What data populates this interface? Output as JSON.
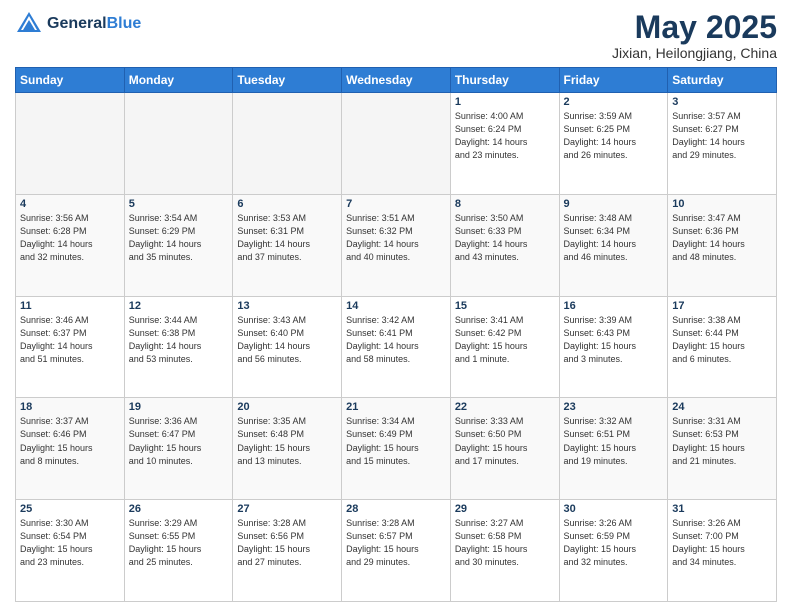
{
  "logo": {
    "line1": "General",
    "line2": "Blue"
  },
  "header": {
    "month": "May 2025",
    "location": "Jixian, Heilongjiang, China"
  },
  "days_of_week": [
    "Sunday",
    "Monday",
    "Tuesday",
    "Wednesday",
    "Thursday",
    "Friday",
    "Saturday"
  ],
  "weeks": [
    [
      {
        "day": "",
        "info": ""
      },
      {
        "day": "",
        "info": ""
      },
      {
        "day": "",
        "info": ""
      },
      {
        "day": "",
        "info": ""
      },
      {
        "day": "1",
        "info": "Sunrise: 4:00 AM\nSunset: 6:24 PM\nDaylight: 14 hours\nand 23 minutes."
      },
      {
        "day": "2",
        "info": "Sunrise: 3:59 AM\nSunset: 6:25 PM\nDaylight: 14 hours\nand 26 minutes."
      },
      {
        "day": "3",
        "info": "Sunrise: 3:57 AM\nSunset: 6:27 PM\nDaylight: 14 hours\nand 29 minutes."
      }
    ],
    [
      {
        "day": "4",
        "info": "Sunrise: 3:56 AM\nSunset: 6:28 PM\nDaylight: 14 hours\nand 32 minutes."
      },
      {
        "day": "5",
        "info": "Sunrise: 3:54 AM\nSunset: 6:29 PM\nDaylight: 14 hours\nand 35 minutes."
      },
      {
        "day": "6",
        "info": "Sunrise: 3:53 AM\nSunset: 6:31 PM\nDaylight: 14 hours\nand 37 minutes."
      },
      {
        "day": "7",
        "info": "Sunrise: 3:51 AM\nSunset: 6:32 PM\nDaylight: 14 hours\nand 40 minutes."
      },
      {
        "day": "8",
        "info": "Sunrise: 3:50 AM\nSunset: 6:33 PM\nDaylight: 14 hours\nand 43 minutes."
      },
      {
        "day": "9",
        "info": "Sunrise: 3:48 AM\nSunset: 6:34 PM\nDaylight: 14 hours\nand 46 minutes."
      },
      {
        "day": "10",
        "info": "Sunrise: 3:47 AM\nSunset: 6:36 PM\nDaylight: 14 hours\nand 48 minutes."
      }
    ],
    [
      {
        "day": "11",
        "info": "Sunrise: 3:46 AM\nSunset: 6:37 PM\nDaylight: 14 hours\nand 51 minutes."
      },
      {
        "day": "12",
        "info": "Sunrise: 3:44 AM\nSunset: 6:38 PM\nDaylight: 14 hours\nand 53 minutes."
      },
      {
        "day": "13",
        "info": "Sunrise: 3:43 AM\nSunset: 6:40 PM\nDaylight: 14 hours\nand 56 minutes."
      },
      {
        "day": "14",
        "info": "Sunrise: 3:42 AM\nSunset: 6:41 PM\nDaylight: 14 hours\nand 58 minutes."
      },
      {
        "day": "15",
        "info": "Sunrise: 3:41 AM\nSunset: 6:42 PM\nDaylight: 15 hours\nand 1 minute."
      },
      {
        "day": "16",
        "info": "Sunrise: 3:39 AM\nSunset: 6:43 PM\nDaylight: 15 hours\nand 3 minutes."
      },
      {
        "day": "17",
        "info": "Sunrise: 3:38 AM\nSunset: 6:44 PM\nDaylight: 15 hours\nand 6 minutes."
      }
    ],
    [
      {
        "day": "18",
        "info": "Sunrise: 3:37 AM\nSunset: 6:46 PM\nDaylight: 15 hours\nand 8 minutes."
      },
      {
        "day": "19",
        "info": "Sunrise: 3:36 AM\nSunset: 6:47 PM\nDaylight: 15 hours\nand 10 minutes."
      },
      {
        "day": "20",
        "info": "Sunrise: 3:35 AM\nSunset: 6:48 PM\nDaylight: 15 hours\nand 13 minutes."
      },
      {
        "day": "21",
        "info": "Sunrise: 3:34 AM\nSunset: 6:49 PM\nDaylight: 15 hours\nand 15 minutes."
      },
      {
        "day": "22",
        "info": "Sunrise: 3:33 AM\nSunset: 6:50 PM\nDaylight: 15 hours\nand 17 minutes."
      },
      {
        "day": "23",
        "info": "Sunrise: 3:32 AM\nSunset: 6:51 PM\nDaylight: 15 hours\nand 19 minutes."
      },
      {
        "day": "24",
        "info": "Sunrise: 3:31 AM\nSunset: 6:53 PM\nDaylight: 15 hours\nand 21 minutes."
      }
    ],
    [
      {
        "day": "25",
        "info": "Sunrise: 3:30 AM\nSunset: 6:54 PM\nDaylight: 15 hours\nand 23 minutes."
      },
      {
        "day": "26",
        "info": "Sunrise: 3:29 AM\nSunset: 6:55 PM\nDaylight: 15 hours\nand 25 minutes."
      },
      {
        "day": "27",
        "info": "Sunrise: 3:28 AM\nSunset: 6:56 PM\nDaylight: 15 hours\nand 27 minutes."
      },
      {
        "day": "28",
        "info": "Sunrise: 3:28 AM\nSunset: 6:57 PM\nDaylight: 15 hours\nand 29 minutes."
      },
      {
        "day": "29",
        "info": "Sunrise: 3:27 AM\nSunset: 6:58 PM\nDaylight: 15 hours\nand 30 minutes."
      },
      {
        "day": "30",
        "info": "Sunrise: 3:26 AM\nSunset: 6:59 PM\nDaylight: 15 hours\nand 32 minutes."
      },
      {
        "day": "31",
        "info": "Sunrise: 3:26 AM\nSunset: 7:00 PM\nDaylight: 15 hours\nand 34 minutes."
      }
    ]
  ]
}
